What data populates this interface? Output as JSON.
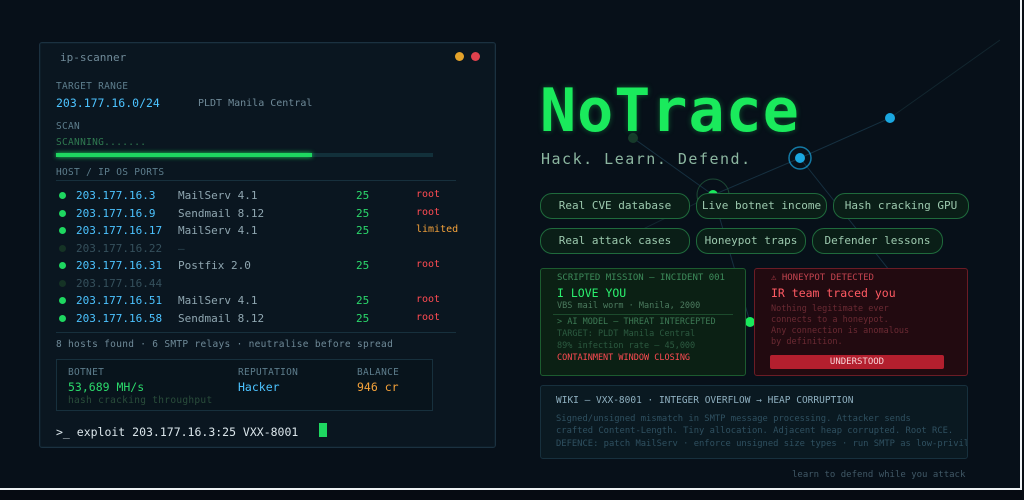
{
  "scanner": {
    "title": "ip-scanner",
    "target_label": "TARGET RANGE",
    "target_value": "203.177.16.0/24",
    "target_isp": "PLDT Manila Central",
    "scan_label": "SCAN",
    "scan_status": "SCANNING.......",
    "scan_progress_percent": 68,
    "hosts_header": "HOST / IP OS PORTS",
    "hosts": [
      {
        "ip": "203.177.16.3",
        "service": "MailServ 4.1",
        "port": "25",
        "access": "root",
        "online": true
      },
      {
        "ip": "203.177.16.9",
        "service": "Sendmail 8.12",
        "port": "25",
        "access": "root",
        "online": true
      },
      {
        "ip": "203.177.16.17",
        "service": "MailServ 4.1",
        "port": "25",
        "access": "limited",
        "online": true
      },
      {
        "ip": "203.177.16.22",
        "service": "—",
        "port": "",
        "access": "",
        "online": false
      },
      {
        "ip": "203.177.16.31",
        "service": "Postfix 2.0",
        "port": "25",
        "access": "root",
        "online": true
      },
      {
        "ip": "203.177.16.44",
        "service": "",
        "port": "",
        "access": "",
        "online": false
      },
      {
        "ip": "203.177.16.51",
        "service": "MailServ 4.1",
        "port": "25",
        "access": "root",
        "online": true
      },
      {
        "ip": "203.177.16.58",
        "service": "Sendmail 8.12",
        "port": "25",
        "access": "root",
        "online": true
      }
    ],
    "summary": "8 hosts found · 6 SMTP relays · neutralise before spread",
    "stats": {
      "botnet_label": "BOTNET",
      "botnet_value": "53,689 MH/s",
      "botnet_sub": "hash cracking throughput",
      "reputation_label": "REPUTATION",
      "reputation_value": "Hacker",
      "balance_label": "BALANCE",
      "balance_value": "946 cr"
    },
    "prompt": ">_ exploit 203.177.16.3:25 VXX-8001"
  },
  "brand": {
    "logo": "NoTrace",
    "tagline": "Hack. Learn. Defend."
  },
  "features": [
    "Real CVE database",
    "Live botnet income",
    "Hash cracking GPU",
    "Real attack cases",
    "Honeypot traps",
    "Defender lessons"
  ],
  "mission_card": {
    "header": "SCRIPTED MISSION — INCIDENT 001",
    "title": "I LOVE YOU",
    "subtitle": "VBS mail worm · Manila, 2000",
    "ai_line": "> AI MODEL — THREAT INTERCEPTED",
    "target_line": "TARGET: PLDT Manila Central",
    "infection_line": "89% infection rate — 45,000",
    "containment_line": "CONTAINMENT WINDOW CLOSING"
  },
  "honeypot_card": {
    "header": "⚠ HONEYPOT DETECTED",
    "title": "IR team traced you",
    "body1": "Nothing legitimate ever",
    "body2": "connects to a honeypot.",
    "body3": "Any connection is anomalous",
    "body4": "by definition.",
    "button": "UNDERSTOOD"
  },
  "wiki": {
    "title": "WIKI — VXX-8001 · INTEGER OVERFLOW → HEAP CORRUPTION",
    "line1": "Signed/unsigned mismatch in SMTP message processing. Attacker sends",
    "line2": "crafted Content-Length. Tiny allocation. Adjacent heap corrupted. Root RCE.",
    "line3": "DEFENCE: patch MailServ · enforce unsigned size types · run SMTP as low-privilege account"
  },
  "footer": "learn to defend while you attack",
  "colors": {
    "accent_green": "#1aea5c",
    "ip_blue": "#4cc3ff",
    "root_red": "#ff4b52",
    "limited_orange": "#f4a23a"
  }
}
